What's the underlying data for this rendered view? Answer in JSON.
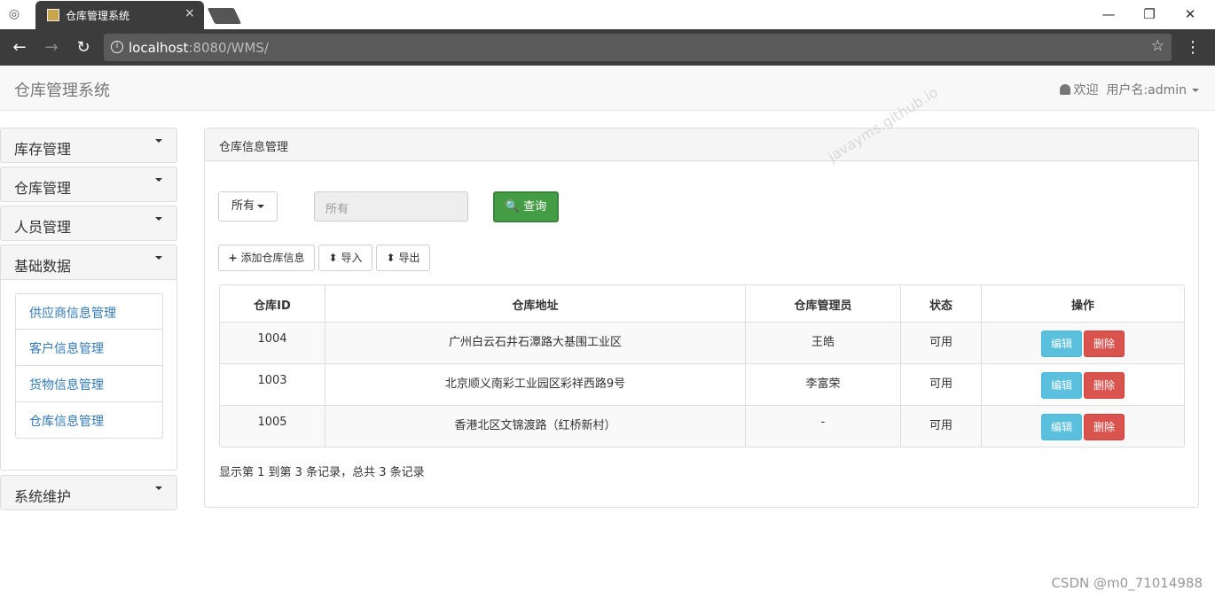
{
  "browser": {
    "tab_title": "仓库管理系统",
    "tab_close": "×",
    "url_host": "localhost",
    "url_rest": ":8080/WMS/",
    "back": "←",
    "forward": "→",
    "reload": "↻",
    "star": "☆",
    "menu": "⋮",
    "minimize": "—",
    "maximize": "❐",
    "close": "✕"
  },
  "navbar": {
    "brand": "仓库管理系统",
    "welcome": "欢迎",
    "username": "用户名:admin"
  },
  "sidebar": {
    "groups": [
      {
        "label": "库存管理"
      },
      {
        "label": "仓库管理"
      },
      {
        "label": "人员管理"
      },
      {
        "label": "基础数据",
        "items": [
          "供应商信息管理",
          "客户信息管理",
          "货物信息管理",
          "仓库信息管理"
        ]
      },
      {
        "label": "系统维护"
      }
    ]
  },
  "panel": {
    "title": "仓库信息管理",
    "filter_label": "所有",
    "filter_placeholder": "所有",
    "query_label": "查询",
    "add_label": "添加仓库信息",
    "import_label": "导入",
    "export_label": "导出",
    "columns": [
      "仓库ID",
      "仓库地址",
      "仓库管理员",
      "状态",
      "操作"
    ],
    "rows": [
      {
        "id": "1004",
        "address": "广州白云石井石潭路大基围工业区",
        "manager": "王皓",
        "status": "可用"
      },
      {
        "id": "1003",
        "address": "北京顺义南彩工业园区彩祥西路9号",
        "manager": "李富荣",
        "status": "可用"
      },
      {
        "id": "1005",
        "address": "香港北区文锦渡路（红桥新村）",
        "manager": "-",
        "status": "可用"
      }
    ],
    "edit_label": "编辑",
    "delete_label": "删除",
    "summary": "显示第 1 到第 3 条记录，总共 3 条记录"
  },
  "watermark": "javayms.github.io",
  "footer_credit": "CSDN @m0_71014988"
}
